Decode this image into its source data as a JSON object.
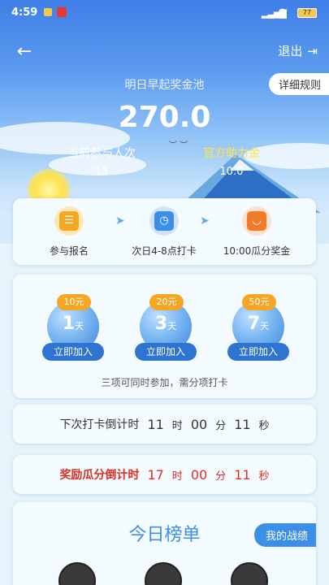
{
  "status_bar": {
    "time": "4:59",
    "battery": "77"
  },
  "header": {
    "logout_label": "退出"
  },
  "pool": {
    "title": "明日早起奖金池",
    "amount": "270.0",
    "rules_label": "详细规则",
    "participants_label": "当前参与人次",
    "participants_value": "13",
    "official_label": "官方助力金",
    "official_value": "10.0"
  },
  "steps": [
    {
      "label": "参与报名",
      "icon": "calendar-icon",
      "color": "#f5a623"
    },
    {
      "label": "次日4-8点打卡",
      "icon": "clock-icon",
      "color": "#3c8ee6"
    },
    {
      "label": "10:00瓜分奖金",
      "icon": "wallet-icon",
      "color": "#f07b2a"
    }
  ],
  "plans": {
    "items": [
      {
        "price": "10元",
        "days": "1",
        "unit": "天",
        "join_label": "立即加入"
      },
      {
        "price": "20元",
        "days": "3",
        "unit": "天",
        "join_label": "立即加入"
      },
      {
        "price": "50元",
        "days": "7",
        "unit": "天",
        "join_label": "立即加入"
      }
    ],
    "note": "三项可同时参加，需分项打卡"
  },
  "countdown_checkin": {
    "label": "下次打卡倒计时",
    "hours": "11",
    "h_unit": "时",
    "minutes": "00",
    "m_unit": "分",
    "seconds": "11",
    "s_unit": "秒"
  },
  "countdown_reward": {
    "label": "奖励瓜分倒计时",
    "hours": "17",
    "h_unit": "时",
    "minutes": "00",
    "m_unit": "分",
    "seconds": "11",
    "s_unit": "秒"
  },
  "ranking": {
    "title": "今日榜单",
    "my_record_label": "我的战绩"
  }
}
